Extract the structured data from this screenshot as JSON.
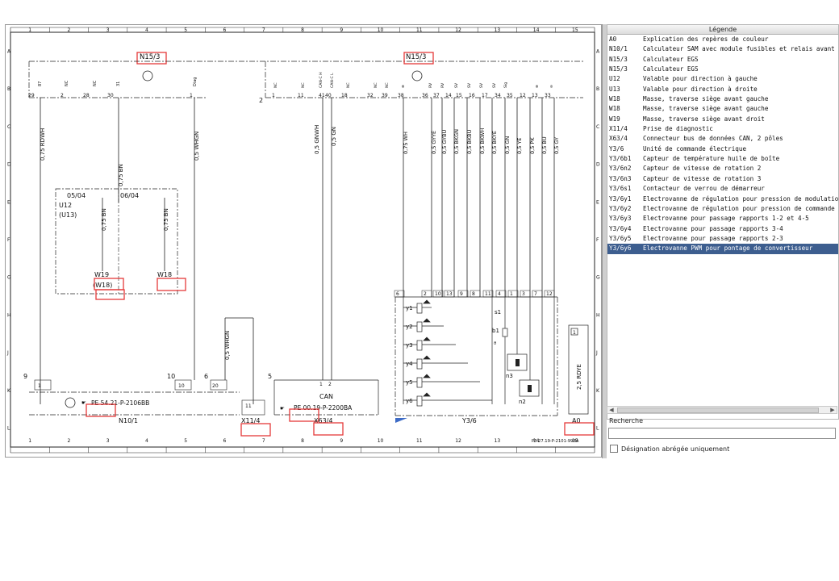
{
  "legend": {
    "title": "Légende",
    "rows": [
      {
        "code": "A0",
        "desc": "Explication des repères de couleur"
      },
      {
        "code": "N10/1",
        "desc": "Calculateur SAM avec module fusibles et relais avant"
      },
      {
        "code": "N15/3",
        "desc": "Calculateur EGS"
      },
      {
        "code": "N15/3",
        "desc": "Calculateur EGS"
      },
      {
        "code": "U12",
        "desc": "Valable pour direction à gauche"
      },
      {
        "code": "U13",
        "desc": "Valable pour direction à droite"
      },
      {
        "code": "W18",
        "desc": "Masse, traverse siège avant gauche"
      },
      {
        "code": "W18",
        "desc": "Masse, traverse siège avant gauche"
      },
      {
        "code": "W19",
        "desc": "Masse, traverse siège avant droit"
      },
      {
        "code": "X11/4",
        "desc": "Prise de diagnostic"
      },
      {
        "code": "X63/4",
        "desc": "Connecteur bus de données CAN, 2 pôles"
      },
      {
        "code": "Y3/6",
        "desc": "Unité de commande électrique"
      },
      {
        "code": "Y3/6b1",
        "desc": "Capteur de température  huile de boîte"
      },
      {
        "code": "Y3/6n2",
        "desc": "Capteur de vitesse de rotation 2"
      },
      {
        "code": "Y3/6n3",
        "desc": "Capteur de vitesse de rotation 3"
      },
      {
        "code": "Y3/6s1",
        "desc": "Contacteur de verrou de démarreur"
      },
      {
        "code": "Y3/6y1",
        "desc": "Electrovanne de régulation pour pression de modulation"
      },
      {
        "code": "Y3/6y2",
        "desc": "Electrovanne de régulation pour pression de commande"
      },
      {
        "code": "Y3/6y3",
        "desc": "Electrovanne pour passage rapports 1-2 et 4-5"
      },
      {
        "code": "Y3/6y4",
        "desc": "Electrovanne pour passage rapports 3-4"
      },
      {
        "code": "Y3/6y5",
        "desc": "Electrovanne pour passage rapports 2-3"
      },
      {
        "code": "Y3/6y6",
        "desc": "Electrovanne PWM pour pontage de convertisseur",
        "selected": true
      }
    ],
    "search_label": "Recherche",
    "search_value": "",
    "checkbox_label": "Désignation abrégée uniquement",
    "checkbox_checked": false
  },
  "diagram": {
    "col_numbers": [
      "1",
      "2",
      "3",
      "4",
      "5",
      "6",
      "7",
      "8",
      "9",
      "10",
      "11",
      "12",
      "13",
      "14",
      "15"
    ],
    "row_letters": [
      "A",
      "B",
      "C",
      "D",
      "E",
      "F",
      "G",
      "H",
      "J",
      "K",
      "L"
    ],
    "components": {
      "n15_3_a": "N15/3",
      "n15_3_b": "N15/3",
      "n10_1": "N10/1",
      "x11_4": "X11/4",
      "x63_4": "X63/4",
      "y3_6": "Y3/6",
      "a0": "A0",
      "u12": "U12",
      "u13": "(U13)",
      "w19": "W19",
      "w18_paren": "(W18)",
      "w18": "W18",
      "can": "CAN",
      "y1": "y1",
      "y2": "y2",
      "y3": "y3",
      "y4": "y4",
      "y5": "y5",
      "y6": "y6",
      "s1": "s1",
      "b1": "b1",
      "n3": "n3",
      "n2": "n2",
      "q": "ϑ"
    },
    "dates": {
      "left": "05/04",
      "right": "06/04"
    },
    "refs": {
      "n10": "PE 54.21-P-2106BB",
      "can": "PE 00.19-P-2200BA",
      "doc": "PE 27.19-P-2101-99BA"
    },
    "wires": {
      "w1": "0,75 RDWH",
      "w2": "0,75 BN",
      "w3": "0,5 WHGN",
      "w4": "0,5 GNWH",
      "w5": "0,5 GN",
      "w6": "0,75 WH",
      "w7": "0,5 GYYE",
      "w8": "0,5 GYBU",
      "w9": "0,5 BKGN",
      "w10": "0,5 BKBU",
      "w11": "0,5 BKWH",
      "w12": "0,5 BKYE",
      "w13": "0,5 GN",
      "w14": "0,5 YE",
      "w15": "0,5 PK",
      "w16": "0,5 BU",
      "w17": "0,5 GY",
      "w18": "0,75 BN",
      "w19": "0,75 BN",
      "w20": "0,5 WHGN",
      "w21": "2,5 RDYE"
    },
    "pins_top_left": [
      "29",
      "2",
      "28",
      "30",
      "1"
    ],
    "pin_labels_left": [
      "87",
      "NC",
      "NC",
      "31",
      "Diag"
    ],
    "pins_top_right": [
      "1",
      "11",
      "41",
      "40",
      "18",
      "32",
      "39",
      "38",
      "36",
      "37",
      "14",
      "15",
      "16",
      "17",
      "34",
      "35",
      "12",
      "13",
      "33"
    ],
    "pin_labels_right": [
      "NC",
      "NC",
      "CAN-C H",
      "CAN-C L",
      "NC",
      "NC",
      "NC",
      "⊕",
      "RV",
      "RV",
      "SV",
      "SV",
      "SV",
      "SV",
      "Sig",
      "⊕",
      "⊖"
    ],
    "y36_pins": [
      "6",
      "2",
      "10",
      "13",
      "9",
      "8",
      "11",
      "4",
      "1",
      "3",
      "7",
      "12"
    ],
    "misc": {
      "n9": "9",
      "n10": "10",
      "n6": "6",
      "n5": "5",
      "n2": "2",
      "p1": "1",
      "p20": "20",
      "p11": "11",
      "p1b": "1",
      "p2": "2",
      "p10": "10"
    }
  }
}
